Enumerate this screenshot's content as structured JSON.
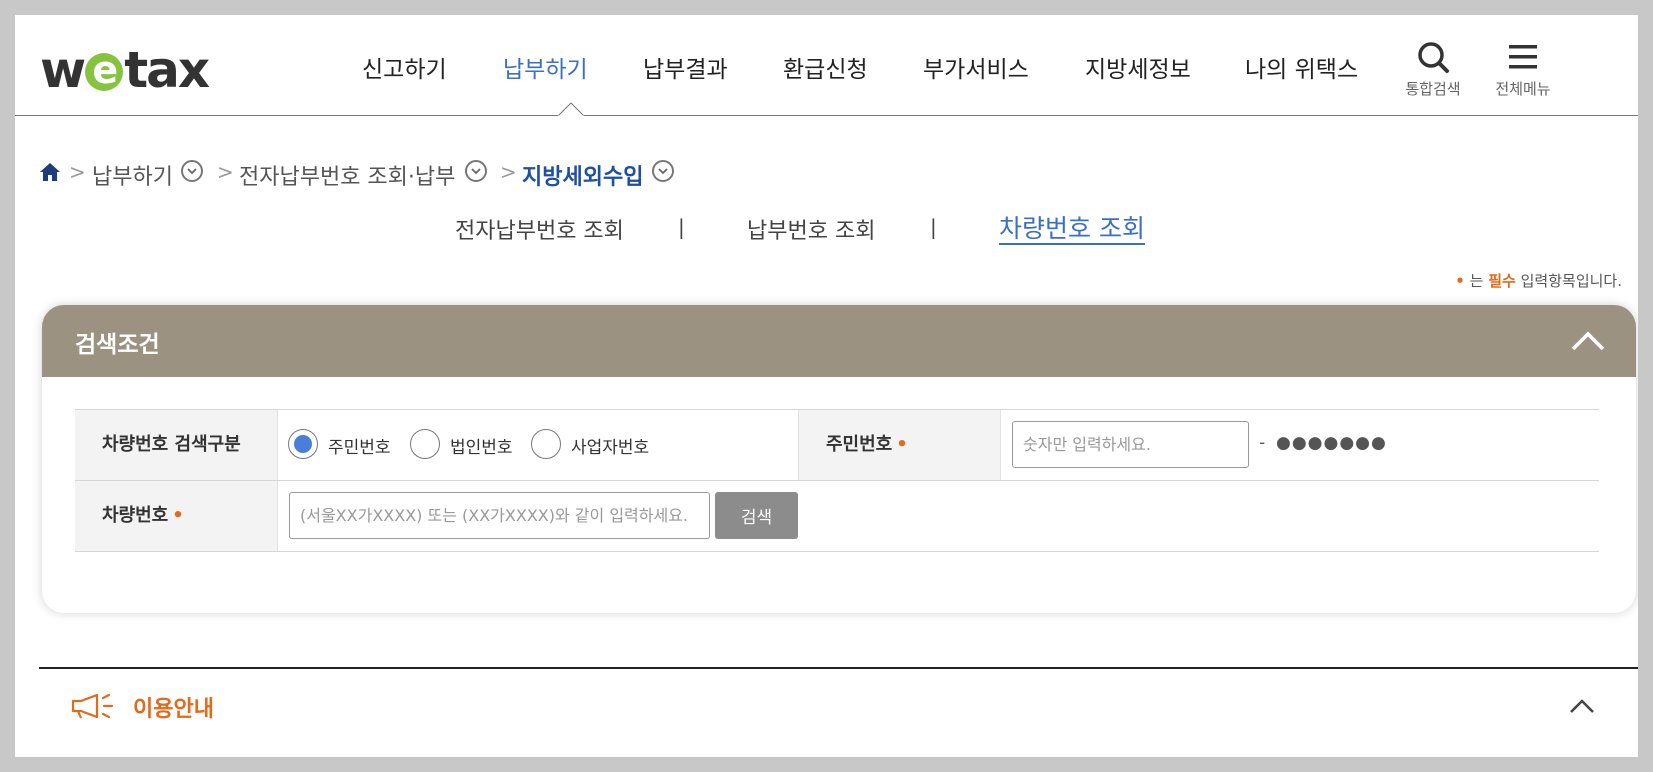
{
  "header": {
    "logo": {
      "w": "w",
      "e": "e",
      "tax": "tax"
    },
    "nav": [
      "신고하기",
      "납부하기",
      "납부결과",
      "환급신청",
      "부가서비스",
      "지방세정보",
      "나의 위택스"
    ],
    "active_nav": "납부하기",
    "tools": {
      "search_label": "통합검색",
      "menu_label": "전체메뉴"
    }
  },
  "breadcrumb": {
    "items": [
      "납부하기",
      "전자납부번호 조회·납부",
      "지방세외수입"
    ]
  },
  "tabs": {
    "items": [
      "전자납부번호 조회",
      "납부번호 조회",
      "차량번호 조회"
    ],
    "separator": "|",
    "active": "차량번호 조회"
  },
  "required_note": {
    "dot": "•",
    "pre": "는 ",
    "strong": "필수",
    "post": " 입력항목입니다."
  },
  "search_panel": {
    "title": "검색조건",
    "row1": {
      "label": "차량번호 검색구분",
      "radios": [
        {
          "label": "주민번호",
          "checked": true
        },
        {
          "label": "법인번호",
          "checked": false
        },
        {
          "label": "사업자번호",
          "checked": false
        }
      ],
      "id_label": "주민번호",
      "required_mark": "•",
      "id_placeholder": "숫자만 입력하세요.",
      "dash": "-",
      "masked": "●●●●●●●"
    },
    "row2": {
      "label": "차량번호",
      "required_mark": "•",
      "placeholder": "(서울XX가XXXX) 또는 (XX가XXXX)와 같이 입력하세요.",
      "search_button": "검색"
    }
  },
  "guide": {
    "title": "이용안내"
  },
  "colors": {
    "accent": "#3a6fc4",
    "panel_header": "#9b9281",
    "required": "#e36a1b"
  }
}
